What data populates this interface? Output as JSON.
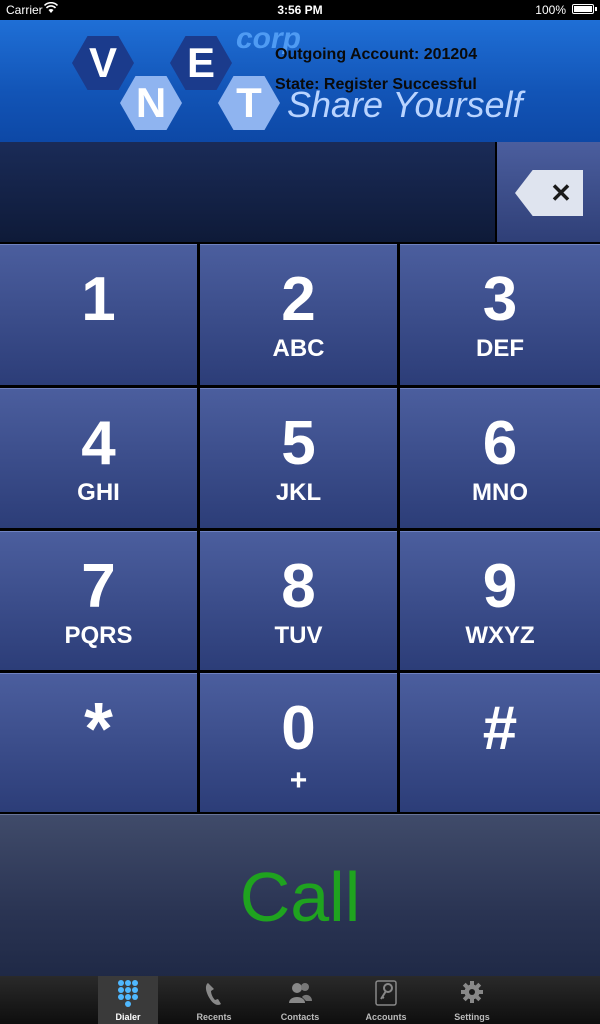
{
  "status_bar": {
    "carrier": "Carrier",
    "time": "3:56 PM",
    "battery": "100%"
  },
  "header": {
    "logo_letters": [
      "V",
      "N",
      "E",
      "T"
    ],
    "logo_word": "corp",
    "account_text": "Outgoing Account: 201204",
    "state_text": "State: Register Successful",
    "tagline": "Share Yourself"
  },
  "dialer": {
    "display_value": "",
    "backspace_icon": "backspace-icon",
    "keys": [
      {
        "num": "1",
        "letters": ""
      },
      {
        "num": "2",
        "letters": "ABC"
      },
      {
        "num": "3",
        "letters": "DEF"
      },
      {
        "num": "4",
        "letters": "GHI"
      },
      {
        "num": "5",
        "letters": "JKL"
      },
      {
        "num": "6",
        "letters": "MNO"
      },
      {
        "num": "7",
        "letters": "PQRS"
      },
      {
        "num": "8",
        "letters": "TUV"
      },
      {
        "num": "9",
        "letters": "WXYZ"
      },
      {
        "num": "*",
        "letters": ""
      },
      {
        "num": "0",
        "letters": "+"
      },
      {
        "num": "#",
        "letters": ""
      }
    ],
    "call_label": "Call",
    "call_color": "#1fa31f"
  },
  "tabs": [
    {
      "label": "Dialer",
      "icon": "keypad-icon",
      "active": true
    },
    {
      "label": "Recents",
      "icon": "phone-handset-icon",
      "active": false
    },
    {
      "label": "Contacts",
      "icon": "contacts-icon",
      "active": false
    },
    {
      "label": "Accounts",
      "icon": "key-icon",
      "active": false
    },
    {
      "label": "Settings",
      "icon": "gear-icon",
      "active": false
    }
  ]
}
